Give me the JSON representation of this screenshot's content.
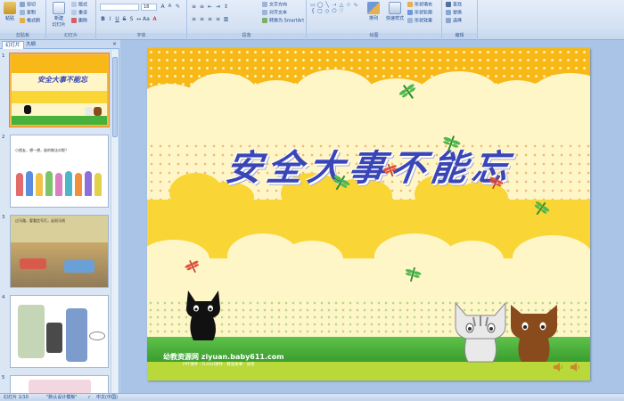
{
  "ribbon": {
    "clipboard": {
      "paste": "粘贴",
      "cut": "剪切",
      "copy": "复制",
      "format_painter": "格式刷",
      "title": "剪贴板"
    },
    "slides": {
      "new_slide": "新建\n幻灯片",
      "layout": "版式",
      "reset": "重设",
      "delete": "删除",
      "title": "幻灯片"
    },
    "font": {
      "font_name": "",
      "font_size": "18",
      "title": "字体"
    },
    "paragraph": {
      "text_direction": "文字方向",
      "align_text": "对齐文本",
      "smartart": "转换为 SmartArt",
      "title": "段落"
    },
    "drawing": {
      "arrange": "排列",
      "quick_styles": "快速样式",
      "shape_fill": "形状填充",
      "shape_outline": "形状轮廓",
      "shape_effects": "形状效果",
      "title": "绘图"
    },
    "editing": {
      "find": "查找",
      "replace": "替换",
      "select": "选择",
      "title": "编辑"
    }
  },
  "panel": {
    "tab_slides": "幻灯片",
    "tab_outline": "大纲",
    "close": "×",
    "thumbnails": [
      {
        "num": "1",
        "title": "安全大事不能忘"
      },
      {
        "num": "2",
        "title": "小朋友，想一想，谁的做法对呢？"
      },
      {
        "num": "3",
        "title": "过马路，要看信号灯，走斑马线"
      },
      {
        "num": "4",
        "title": ""
      },
      {
        "num": "5",
        "title": ""
      }
    ]
  },
  "slide": {
    "title": "安全大事不能忘",
    "footer": "幼教资源网  ziyuan.baby611.com",
    "footer_sub": "PPT课件 · FLASH课件 · 教案故事 · 试卷"
  },
  "statusbar": {
    "slide_info": "幻灯片 1/10",
    "theme": "\"默认设计模板\"",
    "language": "中文(中国)"
  },
  "colors": {
    "ribbon_bg": "#d4e1f3",
    "orange": "#f7b818",
    "yellow_band": "#f9d535",
    "cream": "#fff6c8",
    "grass": "#47b23b",
    "title": "#3a46b6"
  }
}
